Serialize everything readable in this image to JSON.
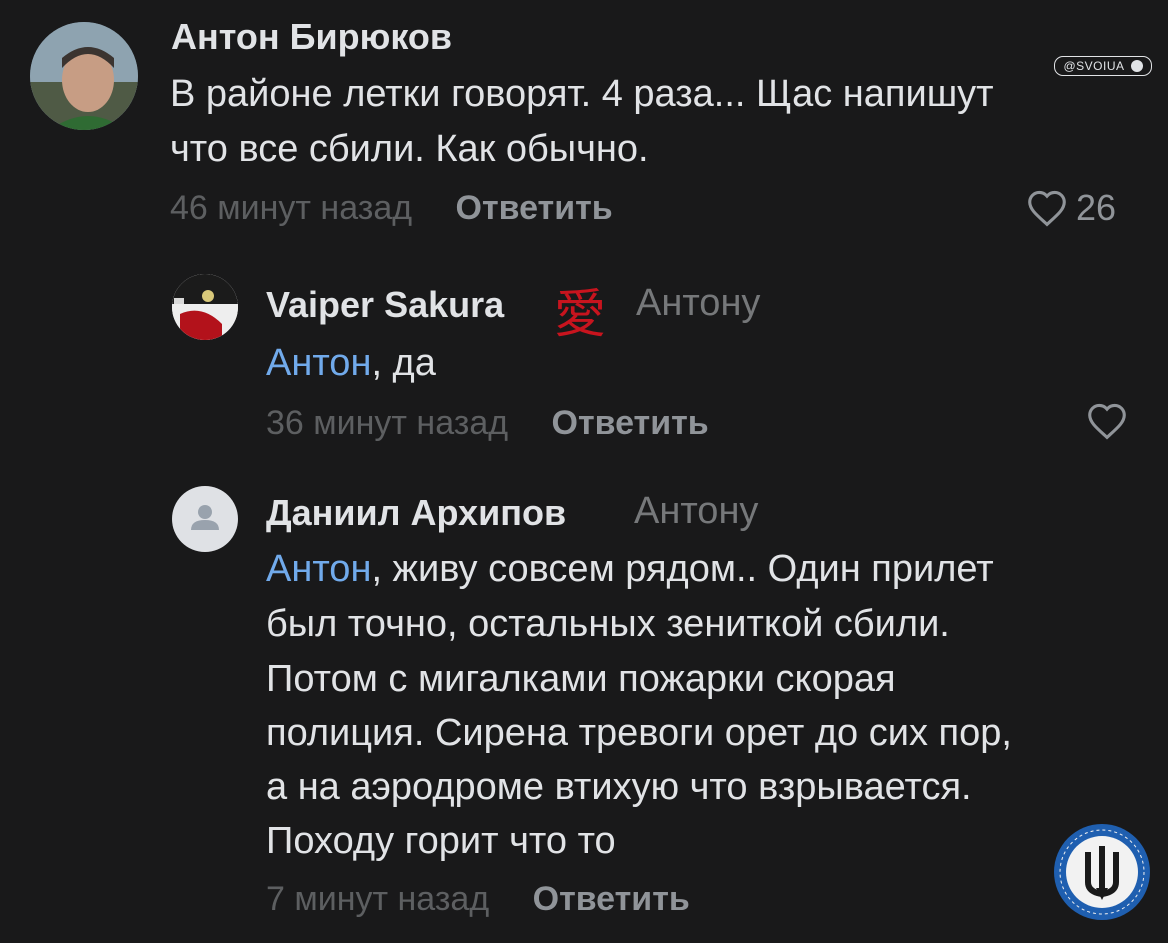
{
  "watermark": "@SVOIUA",
  "comments": [
    {
      "author": "Антон Бирюков",
      "lines": [
        "В районе летки говорят. 4 раза... Щас напишут",
        "что все сбили. Как обычно."
      ],
      "time": "46 минут назад",
      "reply_label": "Ответить",
      "likes": "26"
    },
    {
      "author": "Vaiper Sakura",
      "emoji": "愛",
      "reply_to": "Антону",
      "mention": "Антон",
      "first_line_rest": ", да",
      "time": "36 минут назад",
      "reply_label": "Ответить"
    },
    {
      "author": "Даниил Архипов",
      "reply_to": "Антону",
      "mention": "Антон",
      "first_line_rest": ", живу совсем рядом.. Один прилет",
      "lines": [
        "был точно, остальных зениткой сбили.",
        "Потом с мигалками пожарки скорая",
        "полиция. Сирена тревоги орет до сих пор,",
        "а на аэродроме втихую что взрывается.",
        "Походу горит что то"
      ],
      "time": "7 минут назад",
      "reply_label": "Ответить"
    }
  ],
  "colors": {
    "background": "#19191a",
    "mention": "#71aaeb",
    "text": "#e1e3e6",
    "muted": "#76787a"
  }
}
